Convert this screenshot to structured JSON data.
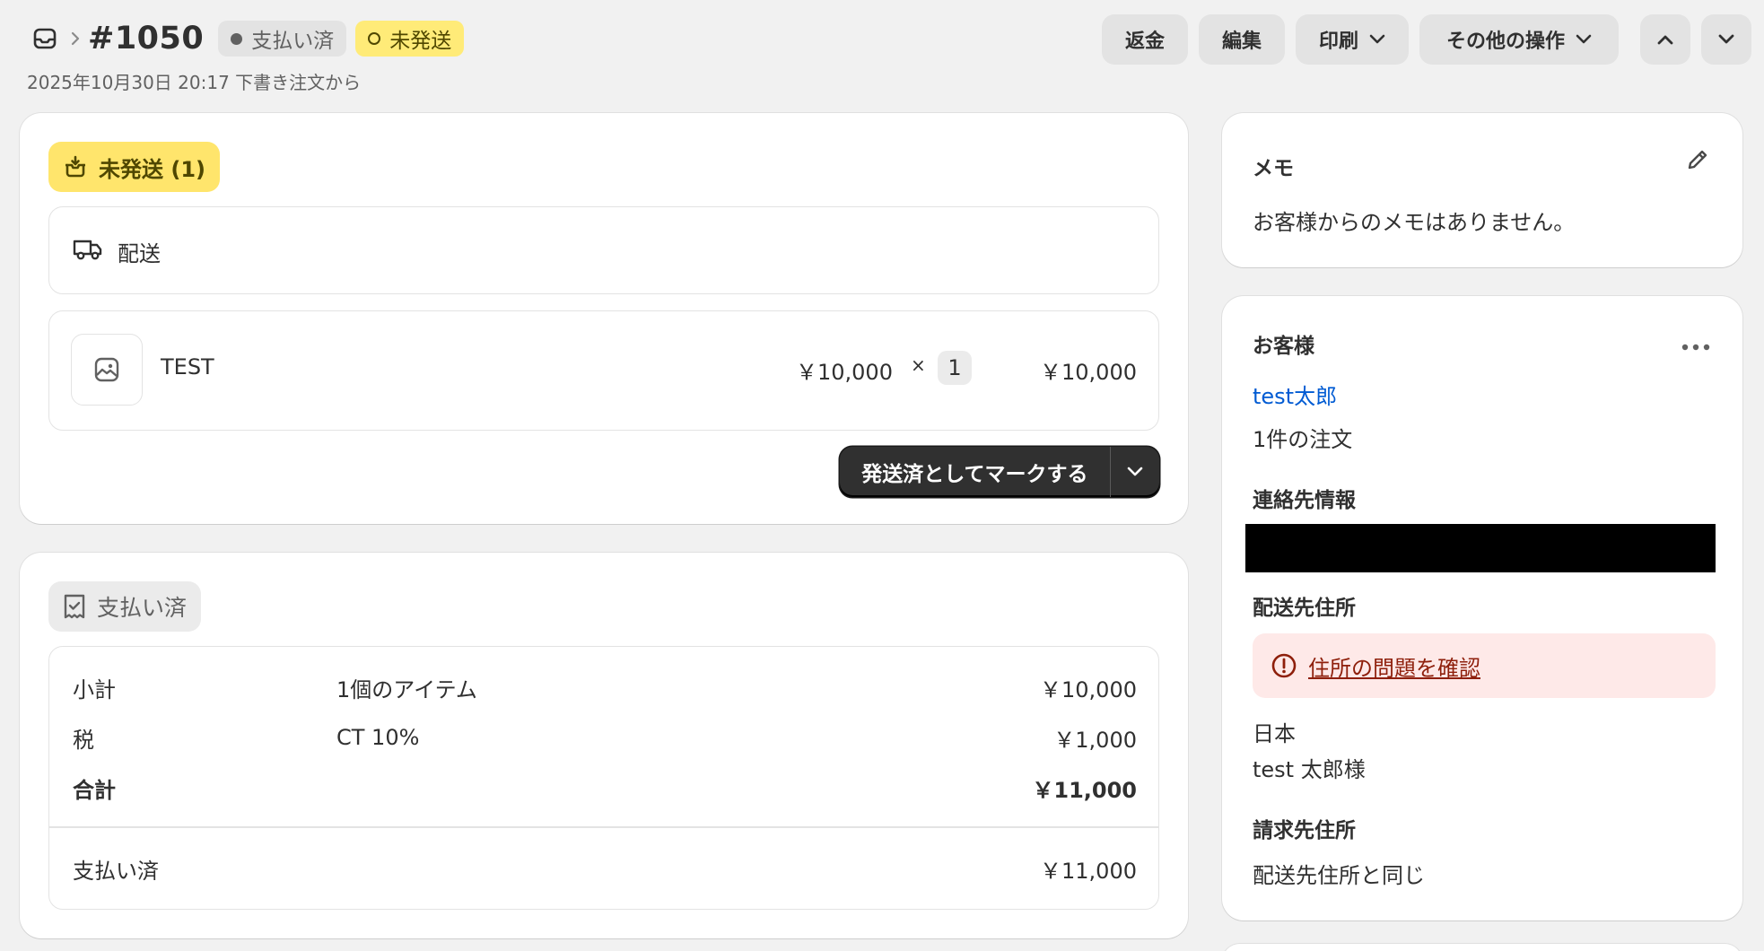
{
  "header": {
    "order_number": "#1050",
    "badges": {
      "paid": "支払い済",
      "unfulfilled": "未発送"
    },
    "subtitle": "2025年10月30日 20:17 下書き注文から",
    "actions": {
      "refund": "返金",
      "edit": "編集",
      "print": "印刷",
      "more": "その他の操作"
    }
  },
  "fulfillment": {
    "status_label": "未発送 (1)",
    "delivery_method": "配送",
    "line_item": {
      "name": "TEST",
      "unit_price": "￥10,000",
      "times": "×",
      "quantity": "1",
      "total": "￥10,000"
    },
    "mark_button": "発送済としてマークする"
  },
  "payment": {
    "status_label": "支払い済",
    "rows": [
      {
        "label": "小計",
        "detail": "1個のアイテム",
        "value": "￥10,000",
        "bold": false
      },
      {
        "label": "税",
        "detail": "CT 10%",
        "value": "￥1,000",
        "bold": false
      },
      {
        "label": "合計",
        "detail": "",
        "value": "￥11,000",
        "bold": true
      }
    ],
    "paid": {
      "label": "支払い済",
      "value": "￥11,000"
    }
  },
  "notes": {
    "title": "メモ",
    "empty_text": "お客様からのメモはありません。"
  },
  "customer": {
    "title": "お客様",
    "name": "test太郎",
    "orders_count": "1件の注文",
    "contact_title": "連絡先情報",
    "shipping_title": "配送先住所",
    "address_alert": "住所の問題を確認",
    "country": "日本",
    "recipient": "test 太郎様",
    "billing_title": "請求先住所",
    "billing_text": "配送先住所と同じ"
  },
  "colors": {
    "background": "#f1f1f1",
    "unfulfilled_badge": "#ffeb78",
    "primary_button": "#303030",
    "link": "#005bd3",
    "alert_bg": "#fee9e8",
    "alert_text": "#8e1f0b"
  }
}
